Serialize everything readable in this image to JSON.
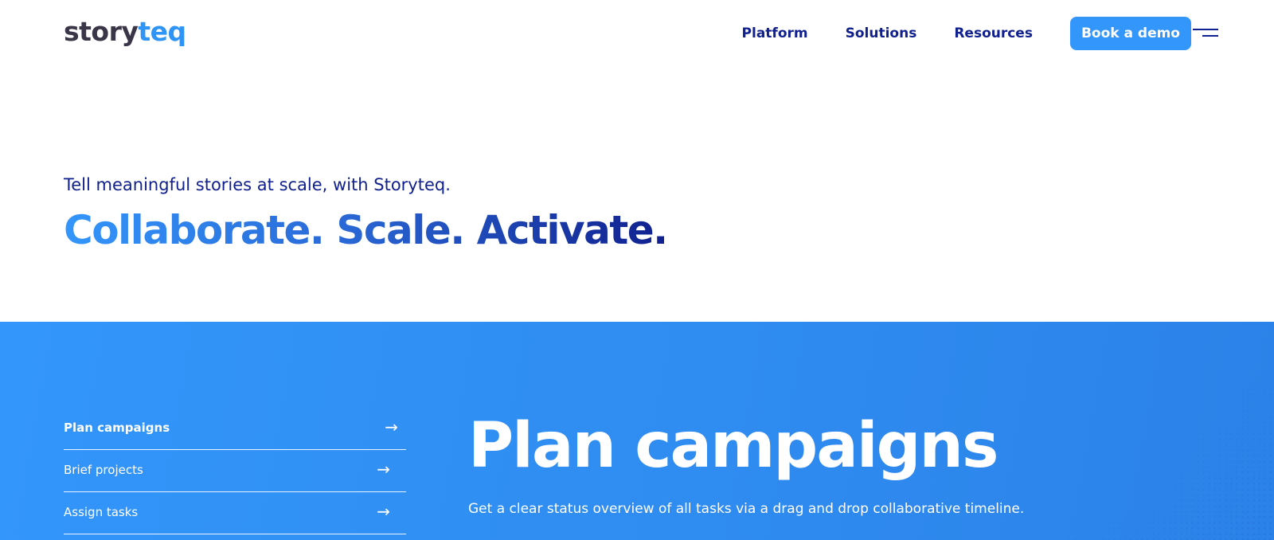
{
  "header": {
    "logo": {
      "part1": "story",
      "part2": "teq"
    },
    "nav": [
      {
        "label": "Platform"
      },
      {
        "label": "Solutions"
      },
      {
        "label": "Resources"
      }
    ],
    "cta_label": "Book a demo",
    "menu_icon": "hamburger-icon"
  },
  "hero": {
    "subtitle": "Tell meaningful stories at scale, with Storyteq.",
    "title": "Collaborate. Scale. Activate."
  },
  "features": {
    "items": [
      {
        "label": "Plan campaigns",
        "active": true,
        "icon": "arrow-right-icon",
        "arrow": "→"
      },
      {
        "label": "Brief projects",
        "active": false,
        "icon": "arrow-right-icon",
        "arrow": "→"
      },
      {
        "label": "Assign tasks",
        "active": false,
        "icon": "arrow-right-icon",
        "arrow": "→"
      }
    ],
    "detail": {
      "title": "Plan campaigns",
      "description": "Get a clear status overview of all tasks via a drag and drop collaborative timeline."
    }
  },
  "colors": {
    "brand_dark": "#3b3548",
    "brand_blue": "#2e94f5",
    "navy": "#10208e",
    "cta_blue": "#3396fa",
    "section_blue": "#2f8cf0"
  }
}
